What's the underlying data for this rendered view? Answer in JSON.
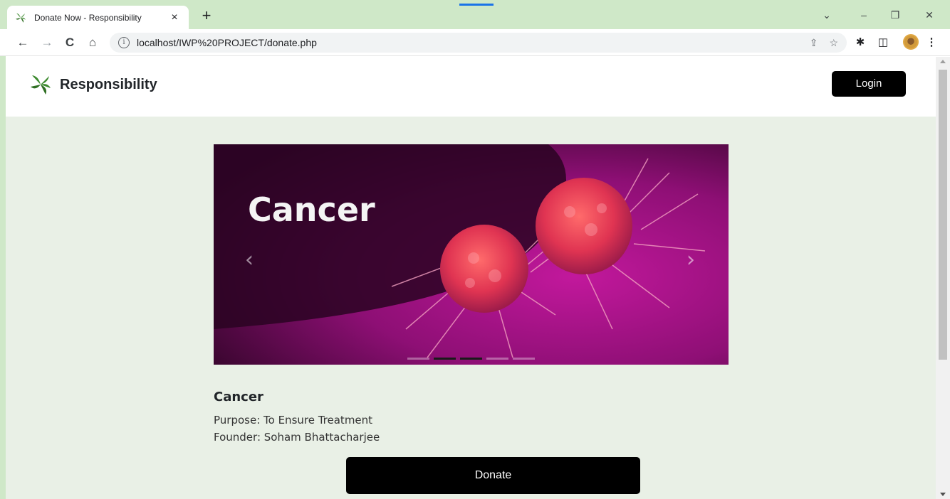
{
  "browser": {
    "tab_title": "Donate Now - Responsibility",
    "tab_close": "×",
    "new_tab": "+",
    "url": "localhost/IWP%20PROJECT/donate.php",
    "window_controls": {
      "collapse": "⌄",
      "minimize": "–",
      "restore": "❐",
      "close": "✕"
    },
    "nav": {
      "back": "←",
      "forward": "→",
      "reload": "C",
      "home": "⌂"
    },
    "omnibox_icons": {
      "share": "⇪",
      "bookmark": "☆"
    },
    "extensions": {
      "puzzle": "✱",
      "sidepanel": "◫",
      "menu": "⋮"
    }
  },
  "header": {
    "brand": "Responsibility",
    "login_label": "Login",
    "brand_color": "#3c8a2e"
  },
  "carousel": {
    "image_caption": "Cancer",
    "prev": "‹",
    "next": "›",
    "slide_count": 5,
    "active_slide": 2
  },
  "cause": {
    "title": "Cancer",
    "purpose": "Purpose: To Ensure Treatment",
    "founder": "Founder: Soham Bhattacharjee"
  },
  "actions": {
    "donate_label": "Donate"
  },
  "colors": {
    "page_bg": "#e9f0e6",
    "tabstrip_bg": "#cfe8c8",
    "button_bg": "#000000"
  }
}
